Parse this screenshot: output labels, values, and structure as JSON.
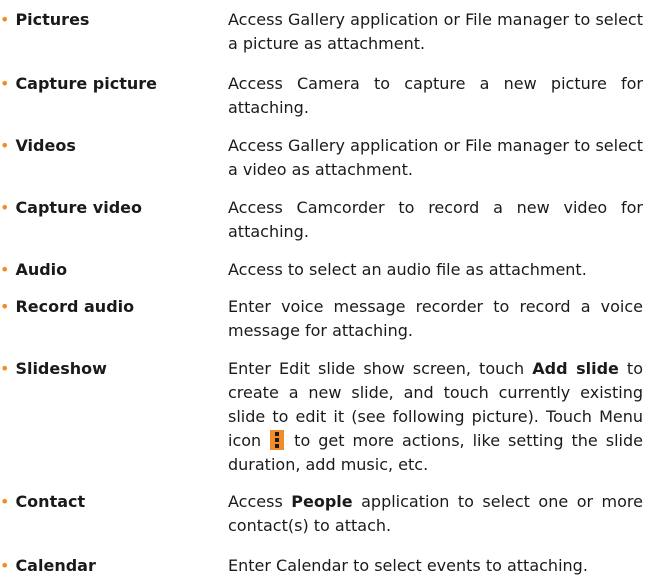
{
  "colors": {
    "bullet": "#f28c28",
    "menu_icon": "#f28c28"
  },
  "items": [
    {
      "term": "Pictures",
      "desc": "Access Gallery application or File manager to select a picture as attachment."
    },
    {
      "term": "Capture picture",
      "desc": "Access Camera to capture a new picture for attaching."
    },
    {
      "term": "Videos",
      "desc": "Access Gallery application or File manager to select a video as attachment."
    },
    {
      "term": "Capture video",
      "desc": "Access Camcorder to record a new video for attaching."
    },
    {
      "term": "Audio",
      "desc": "Access to select an audio file as attachment."
    },
    {
      "term": "Record audio",
      "desc": "Enter voice message recorder to record a voice message for attaching."
    },
    {
      "term": "Slideshow",
      "desc_parts": {
        "p1": "Enter Edit slide show screen, touch ",
        "b1": "Add slide",
        "p2": " to create a new slide, and touch currently existing slide to edit it (see following picture). Touch Menu icon ",
        "icon": "menu-icon",
        "p3": " to get more actions, like setting the slide duration, add music, etc."
      }
    },
    {
      "term": "Contact",
      "desc_parts": {
        "p1": "Access ",
        "b1": "People",
        "p2": " application to select one or more contact(s) to attach."
      }
    },
    {
      "term": "Calendar",
      "desc": "Enter Calendar to select events to attaching."
    }
  ]
}
